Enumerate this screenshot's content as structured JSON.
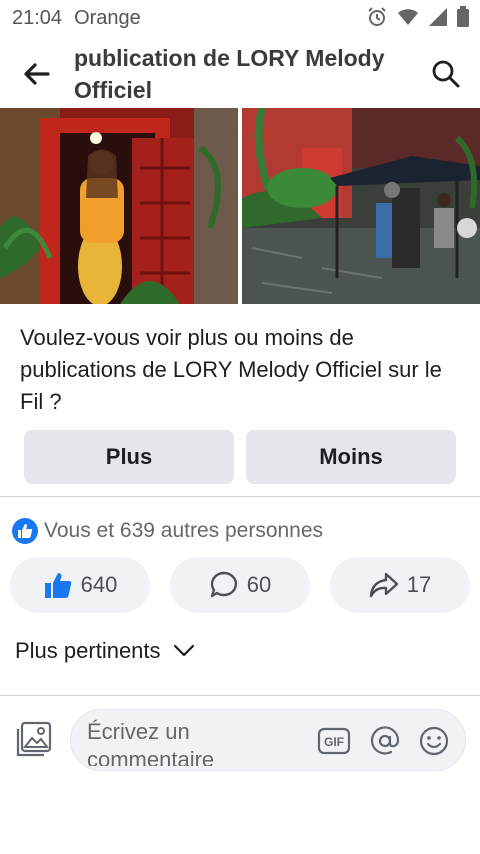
{
  "status_bar": {
    "time": "21:04",
    "carrier": "Orange"
  },
  "header": {
    "title": "publication de LORY Melody Officiel"
  },
  "question": {
    "text": "Voulez-vous voir plus ou moins de publications de LORY Melody Officiel sur le Fil ?",
    "more_label": "Plus",
    "less_label": "Moins"
  },
  "reactions": {
    "summary": "Vous et 639 autres personnes"
  },
  "actions": {
    "likes": "640",
    "comments": "60",
    "shares": "17"
  },
  "sort": {
    "label": "Plus pertinents"
  },
  "composer": {
    "placeholder": "Écrivez un commentaire"
  },
  "colors": {
    "accent": "#1877f2",
    "pill_bg": "#f0f2f5",
    "button_bg": "#e4e6eb"
  }
}
